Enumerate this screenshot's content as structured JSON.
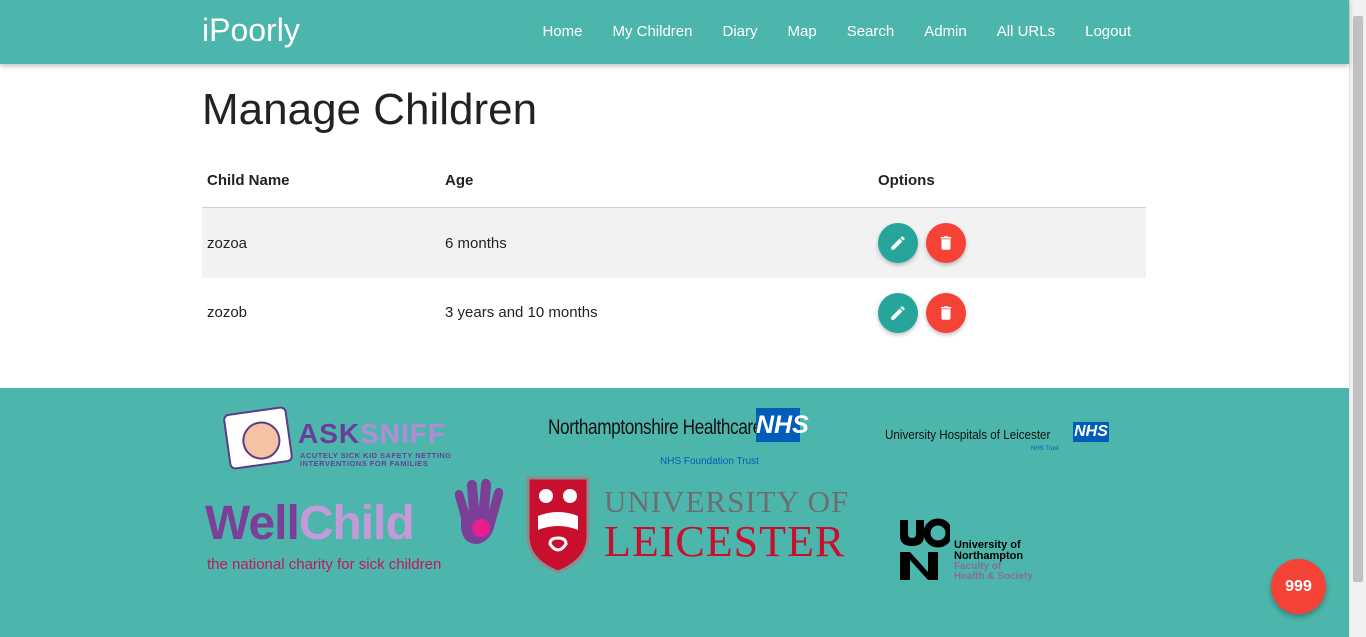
{
  "navbar": {
    "brand": "iPoorly",
    "links": [
      "Home",
      "My Children",
      "Diary",
      "Map",
      "Search",
      "Admin",
      "All URLs",
      "Logout"
    ]
  },
  "page": {
    "title": "Manage Children"
  },
  "table": {
    "headers": {
      "name": "Child Name",
      "age": "Age",
      "options": "Options"
    },
    "rows": [
      {
        "name": "zozoa",
        "age": "6 months"
      },
      {
        "name": "zozob",
        "age": "3 years and 10 months"
      }
    ],
    "edit_icon": "pencil-icon",
    "delete_icon": "trash-icon"
  },
  "footer": {
    "asksniff": {
      "word_a": "ASK",
      "word_b": "SNIFF",
      "tagline_1": "ACUTELY SICK KID SAFETY NETTING",
      "tagline_2": "INTERVENTIONS FOR FAMILIES"
    },
    "northants": {
      "name": "Northamptonshire Healthcare",
      "nhs": "NHS",
      "sub": "NHS Foundation Trust"
    },
    "uhl": {
      "name": "University Hospitals of Leicester",
      "nhs": "NHS",
      "sub": "NHS Trust"
    },
    "wellchild": {
      "word_a": "Well",
      "word_b": "Child",
      "tagline": "the national charity for sick children"
    },
    "uol": {
      "line1": "UNIVERSITY OF",
      "line2": "LEICESTER"
    },
    "uon": {
      "line1": "University of\nNorthampton",
      "line2": "Faculty of\nHealth & Society"
    }
  },
  "emergency_button": {
    "label": "999"
  },
  "colors": {
    "teal": "#4db6ac",
    "edit": "#26a69a",
    "delete": "#f44336"
  }
}
